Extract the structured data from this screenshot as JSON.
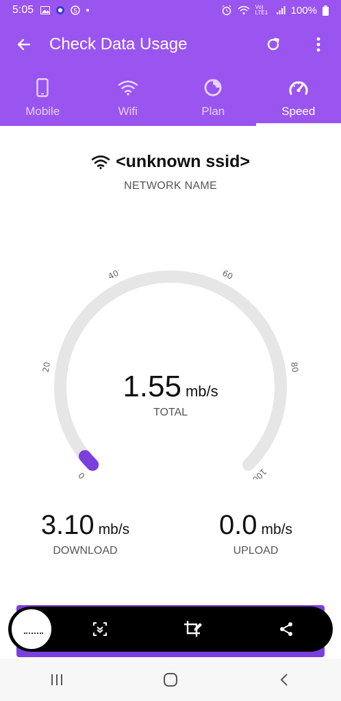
{
  "status_bar": {
    "time": "5:05",
    "battery": "100%",
    "net_label": "Vo) LTE1"
  },
  "app_bar": {
    "title": "Check Data Usage"
  },
  "tabs": [
    {
      "label": "Mobile",
      "icon": "phone-icon"
    },
    {
      "label": "Wifi",
      "icon": "wifi-icon"
    },
    {
      "label": "Plan",
      "icon": "chart-icon"
    },
    {
      "label": "Speed",
      "icon": "speedometer-icon",
      "active": true
    }
  ],
  "network": {
    "ssid": "<unknown ssid>",
    "label": "NETWORK NAME"
  },
  "gauge": {
    "ticks": [
      "0",
      "20",
      "40",
      "60",
      "80",
      "100"
    ],
    "min": 0,
    "max": 100,
    "value": 1.55,
    "track_color": "#e6e6e6",
    "fill_color": "#7a3fdc"
  },
  "total": {
    "value": "1.55",
    "unit": "mb/s",
    "label": "TOTAL"
  },
  "download": {
    "value": "3.10",
    "unit": "mb/s",
    "label": "DOWNLOAD"
  },
  "upload": {
    "value": "0.0",
    "unit": "mb/s",
    "label": "UPLOAD"
  },
  "colors": {
    "accent": "#9a54f0",
    "accent_dark": "#7a3fdc"
  }
}
